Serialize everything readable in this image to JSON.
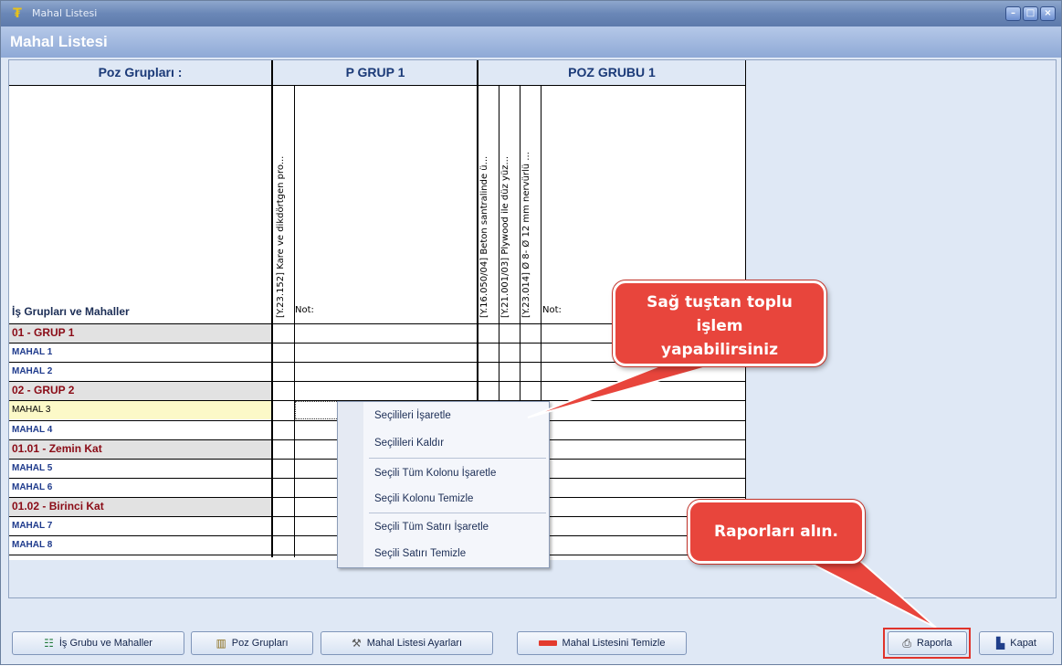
{
  "window": {
    "title": "Mahal Listesi",
    "header": "Mahal Listesi"
  },
  "grid": {
    "poz_gruplari_label": "Poz Grupları :",
    "is_gruplari_label": "İş Grupları ve Mahaller",
    "groups": [
      {
        "name": "P GRUP 1",
        "columns": [
          "[Y.23.152] Kare ve dikdörtgen pro..."
        ],
        "note_label": "Not:"
      },
      {
        "name": "POZ GRUBU 1",
        "columns": [
          "[Y.16.050/04] Beton santralinde ü...",
          "[Y.21.001/03] Plywood ile düz yüz...",
          "[Y.23.014] Ø 8- Ø 12 mm nervürlü ..."
        ],
        "note_label": "Not:"
      }
    ],
    "rows": [
      {
        "label": "01 - GRUP 1",
        "type": "group"
      },
      {
        "label": "MAHAL 1",
        "type": "mahal"
      },
      {
        "label": "MAHAL 2",
        "type": "mahal"
      },
      {
        "label": "02 - GRUP 2",
        "type": "group"
      },
      {
        "label": "MAHAL 3",
        "type": "selected"
      },
      {
        "label": "MAHAL 4",
        "type": "mahal"
      },
      {
        "label": "01.01 - Zemin Kat",
        "type": "group"
      },
      {
        "label": "MAHAL 5",
        "type": "mahal"
      },
      {
        "label": "MAHAL 6",
        "type": "mahal"
      },
      {
        "label": "01.02 - Birinci Kat",
        "type": "group"
      },
      {
        "label": "MAHAL 7",
        "type": "mahal"
      },
      {
        "label": "MAHAL 8",
        "type": "mahal"
      }
    ]
  },
  "context_menu": {
    "items": [
      "Seçilileri İşaretle",
      "Seçilileri Kaldır",
      "Seçili Tüm Kolonu İşaretle",
      "Seçili Kolonu Temizle",
      "Seçili Tüm Satırı İşaretle",
      "Seçili Satırı Temizle"
    ]
  },
  "callouts": {
    "right_click": [
      "Sağ tuştan toplu",
      "işlem",
      "yapabilirsiniz"
    ],
    "reports": "Raporları alın."
  },
  "buttons": {
    "is_grubu": "İş Grubu ve Mahaller",
    "poz_gruplari": "Poz Grupları",
    "ayarlar": "Mahal Listesi Ayarları",
    "temizle": "Mahal Listesini Temizle",
    "raporla": "Raporla",
    "kapat": "Kapat"
  },
  "colors": {
    "accent_red": "#e8453c",
    "group_row_text": "#8a0b16",
    "mahal_row_text": "#1e3a8c",
    "selected_row_bg": "#fcf9c8"
  }
}
